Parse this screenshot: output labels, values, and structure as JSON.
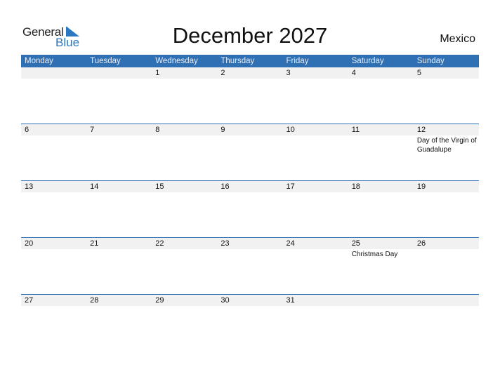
{
  "logo": {
    "general": "General",
    "blue": "Blue"
  },
  "title": "December 2027",
  "country": "Mexico",
  "colors": {
    "accent": "#2f6fb3",
    "band": "#f1f1f1",
    "logo_blue": "#2a78c2"
  },
  "weekdays": [
    "Monday",
    "Tuesday",
    "Wednesday",
    "Thursday",
    "Friday",
    "Saturday",
    "Sunday"
  ],
  "weeks": [
    [
      {
        "d": ""
      },
      {
        "d": ""
      },
      {
        "d": "1"
      },
      {
        "d": "2"
      },
      {
        "d": "3"
      },
      {
        "d": "4"
      },
      {
        "d": "5"
      }
    ],
    [
      {
        "d": "6"
      },
      {
        "d": "7"
      },
      {
        "d": "8"
      },
      {
        "d": "9"
      },
      {
        "d": "10"
      },
      {
        "d": "11"
      },
      {
        "d": "12",
        "e": "Day of the Virgin of Guadalupe"
      }
    ],
    [
      {
        "d": "13"
      },
      {
        "d": "14"
      },
      {
        "d": "15"
      },
      {
        "d": "16"
      },
      {
        "d": "17"
      },
      {
        "d": "18"
      },
      {
        "d": "19"
      }
    ],
    [
      {
        "d": "20"
      },
      {
        "d": "21"
      },
      {
        "d": "22"
      },
      {
        "d": "23"
      },
      {
        "d": "24"
      },
      {
        "d": "25",
        "e": "Christmas Day"
      },
      {
        "d": "26"
      }
    ],
    [
      {
        "d": "27"
      },
      {
        "d": "28"
      },
      {
        "d": "29"
      },
      {
        "d": "30"
      },
      {
        "d": "31"
      },
      {
        "d": ""
      },
      {
        "d": ""
      }
    ]
  ]
}
